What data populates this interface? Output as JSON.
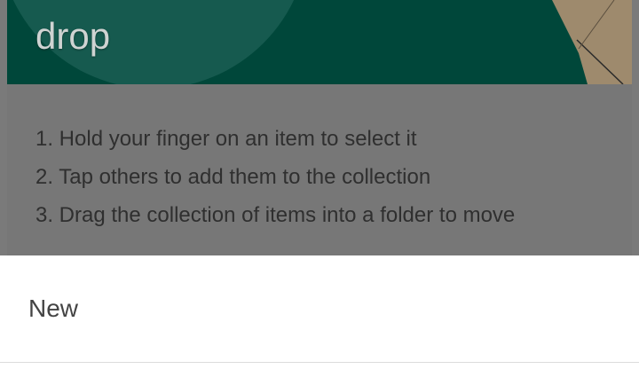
{
  "background": {
    "banner_title": "drop",
    "steps": [
      "1. Hold your finger on an item to select it",
      "2. Tap others to add them to the collection",
      "3. Drag the collection of items into a folder to move"
    ]
  },
  "sheet": {
    "items": [
      {
        "label": "New"
      }
    ]
  },
  "colors": {
    "scrim": "#777777",
    "banner": "#00473a",
    "sheet": "#ffffff"
  }
}
